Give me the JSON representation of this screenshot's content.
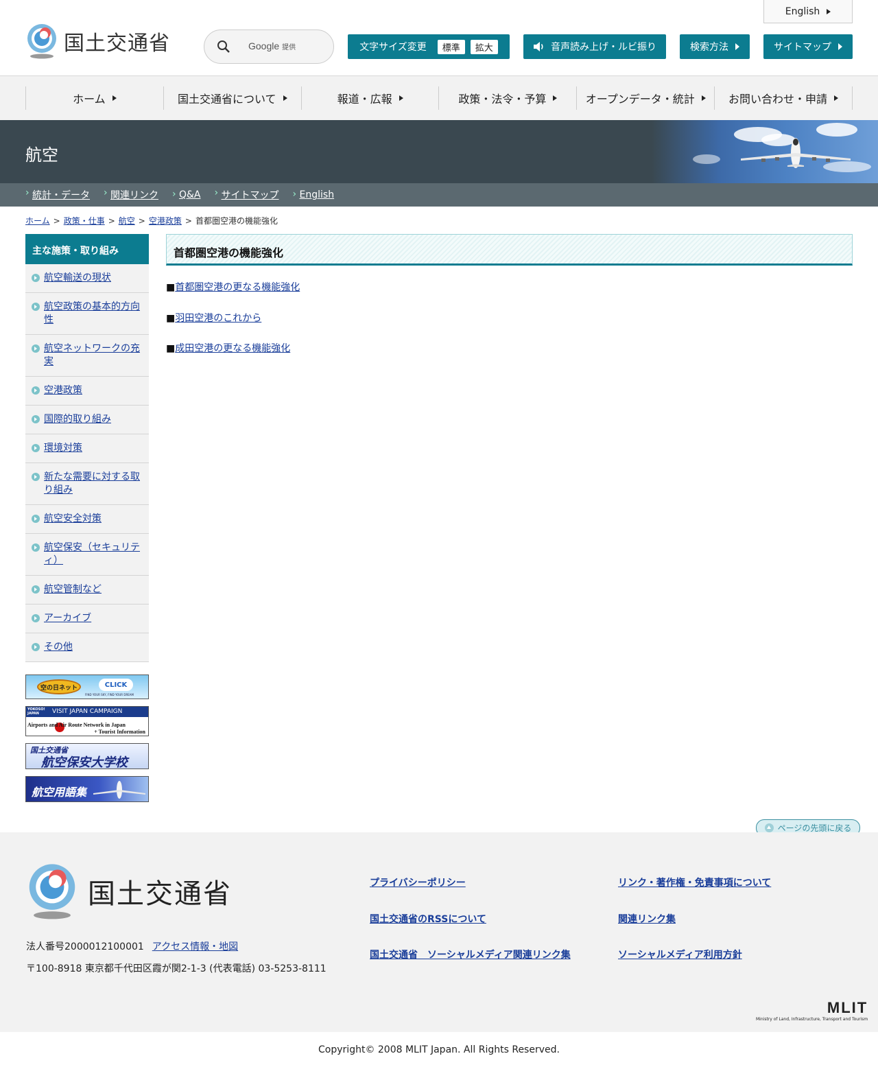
{
  "header": {
    "logo_text": "国土交通省",
    "search_placeholder": "Google",
    "search_provided": "提供",
    "english_label": "English",
    "font_size_label": "文字サイズ変更",
    "font_size_standard": "標準",
    "font_size_large": "拡大",
    "speech_label": "音声読み上げ・ルビ振り",
    "search_method_label": "検索方法",
    "sitemap_label": "サイトマップ"
  },
  "gnav": {
    "items": [
      {
        "label": "ホーム"
      },
      {
        "label": "国土交通省について"
      },
      {
        "label": "報道・広報"
      },
      {
        "label": "政策・法令・予算"
      },
      {
        "label": "オープンデータ・統計"
      },
      {
        "label": "お問い合わせ・申請"
      }
    ]
  },
  "banner": {
    "title": "航空"
  },
  "subnav": {
    "items": [
      {
        "label": "統計・データ"
      },
      {
        "label": "関連リンク"
      },
      {
        "label": "Q&A"
      },
      {
        "label": "サイトマップ"
      },
      {
        "label": "English"
      }
    ]
  },
  "breadcrumb": {
    "items": [
      {
        "label": "ホーム"
      },
      {
        "label": "政策・仕事"
      },
      {
        "label": "航空"
      },
      {
        "label": "空港政策"
      }
    ],
    "current": "首都圏空港の機能強化",
    "separator": ">"
  },
  "sidebar": {
    "heading": "主な施策・取り組み",
    "items": [
      {
        "label": "航空輸送の現状"
      },
      {
        "label": "航空政策の基本的方向性"
      },
      {
        "label": "航空ネットワークの充実"
      },
      {
        "label": "空港政策"
      },
      {
        "label": "国際的取り組み"
      },
      {
        "label": "環境対策"
      },
      {
        "label": "新たな需要に対する取り組み"
      },
      {
        "label": "航空安全対策"
      },
      {
        "label": "航空保安（セキュリティ）"
      },
      {
        "label": "航空管制など"
      },
      {
        "label": "アーカイブ"
      },
      {
        "label": "その他"
      }
    ],
    "banners": {
      "b1_text": "空の日ネット",
      "b1_click": "CLICK",
      "b1_sub": "FIND YOUR SKY, FIND YOUR DREAM",
      "b2_top": "VISIT JAPAN CAMPAIGN",
      "b2_yokoso": "YOKOSO! JAPAN",
      "b2_main": "Airports and Air Route Network in Japan",
      "b2_sub": "+ Tourist Information",
      "b3_top": "国土交通省",
      "b3_main": "航空保安大学校",
      "b4_main": "航空用語集"
    }
  },
  "main": {
    "heading": "首都圏空港の機能強化",
    "bullet": "■",
    "links": [
      {
        "label": "首都圏空港の更なる機能強化"
      },
      {
        "label": "羽田空港のこれから"
      },
      {
        "label": "成田空港の更なる機能強化"
      }
    ]
  },
  "pagetop": {
    "label": "ページの先頭に戻る"
  },
  "footer": {
    "logo_text": "国土交通省",
    "corp_number": "法人番号2000012100001",
    "access_label": "アクセス情報・地図",
    "address": "〒100-8918 東京都千代田区霞が関2-1-3 (代表電話) 03-5253-8111",
    "links": [
      {
        "label": "プライバシーポリシー"
      },
      {
        "label": "リンク・著作権・免責事項について"
      },
      {
        "label": "国土交通省のRSSについて"
      },
      {
        "label": "関連リンク集"
      },
      {
        "label": "国土交通省　ソーシャルメディア関連リンク集"
      },
      {
        "label": "ソーシャルメディア利用方針"
      }
    ],
    "mlit_logo": "MLIT",
    "mlit_sub": "Ministry of Land, Infrastructure, Transport and Tourism",
    "copyright": "Copyright© 2008 MLIT Japan. All Rights Reserved."
  },
  "colors": {
    "teal": "#0c7c90",
    "banner": "#3a4850",
    "subnav": "#5b6970",
    "link": "#1a3e9a"
  }
}
